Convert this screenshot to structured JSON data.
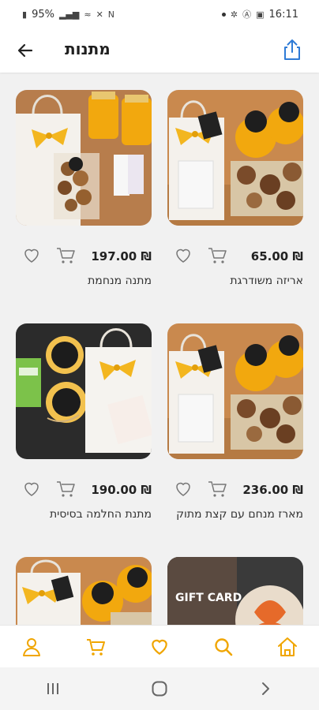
{
  "status_bar": {
    "time": "16:11",
    "battery": "95%"
  },
  "header": {
    "title": "מתנות",
    "back_icon": "arrow-left-icon",
    "share_icon": "share-icon"
  },
  "colors": {
    "accent": "#f0a500",
    "share_blue": "#2f7bd6",
    "text": "#222222"
  },
  "products": [
    {
      "name": "אריזה משודרגת",
      "price": "65.00 ₪"
    },
    {
      "name": "מתנה מנחמת",
      "price": "197.00 ₪"
    },
    {
      "name": "מארז מנחם עם קצת מתוק",
      "price": "236.00 ₪"
    },
    {
      "name": "מתנת החלמה בסיסית",
      "price": "190.00 ₪"
    },
    {
      "gift_card_label": "GIFT CARD"
    }
  ],
  "bottom_nav": [
    "home-icon",
    "search-icon",
    "heart-icon",
    "cart-icon",
    "user-icon"
  ]
}
